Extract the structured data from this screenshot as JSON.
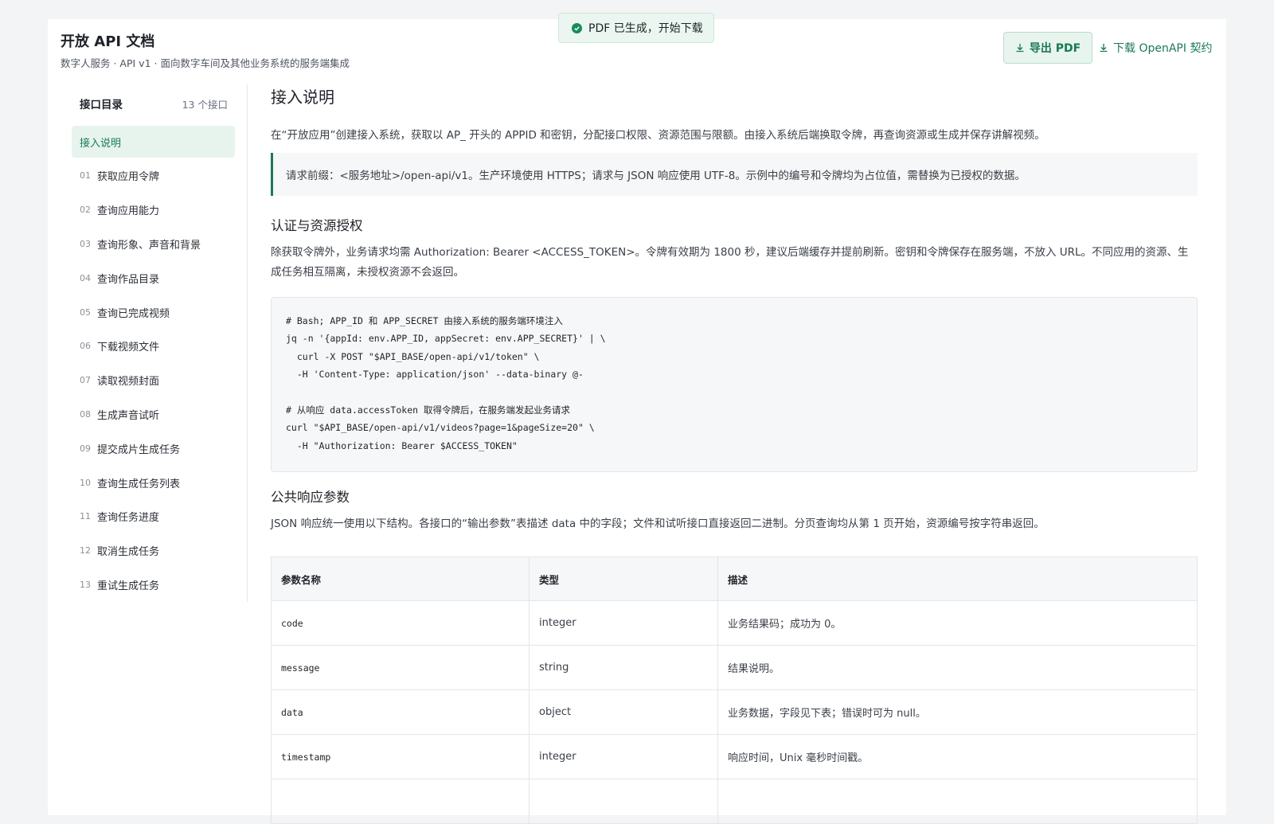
{
  "toast": {
    "text": "PDF 已生成，开始下载"
  },
  "header": {
    "title": "开放 API 文档",
    "subtitle": "数字人服务 · API v1 · 面向数字车间及其他业务系统的服务端集成",
    "export_pdf": "导出 PDF",
    "download_openapi": "下载 OpenAPI 契约"
  },
  "sidebar": {
    "title": "接口目录",
    "count": "13 个接口",
    "items": [
      {
        "num": "",
        "label": "接入说明",
        "active": true
      },
      {
        "num": "01",
        "label": "获取应用令牌"
      },
      {
        "num": "02",
        "label": "查询应用能力"
      },
      {
        "num": "03",
        "label": "查询形象、声音和背景"
      },
      {
        "num": "04",
        "label": "查询作品目录"
      },
      {
        "num": "05",
        "label": "查询已完成视频"
      },
      {
        "num": "06",
        "label": "下载视频文件"
      },
      {
        "num": "07",
        "label": "读取视频封面"
      },
      {
        "num": "08",
        "label": "生成声音试听"
      },
      {
        "num": "09",
        "label": "提交成片生成任务"
      },
      {
        "num": "10",
        "label": "查询生成任务列表"
      },
      {
        "num": "11",
        "label": "查询任务进度"
      },
      {
        "num": "12",
        "label": "取消生成任务"
      },
      {
        "num": "13",
        "label": "重试生成任务"
      }
    ]
  },
  "main": {
    "title": "接入说明",
    "intro": "在“开放应用”创建接入系统，获取以 AP_ 开头的 APPID 和密钥，分配接口权限、资源范围与限额。由接入系统后端换取令牌，再查询资源或生成并保存讲解视频。",
    "note": "请求前缀：<服务地址>/open-api/v1。生产环境使用 HTTPS；请求与 JSON 响应使用 UTF-8。示例中的编号和令牌均为占位值，需替换为已授权的数据。",
    "auth": {
      "title": "认证与资源授权",
      "text": "除获取令牌外，业务请求均需 Authorization: Bearer <ACCESS_TOKEN>。令牌有效期为 1800 秒，建议后端缓存并提前刷新。密钥和令牌保存在服务端，不放入 URL。不同应用的资源、生成任务相互隔离，未授权资源不会返回。"
    },
    "code_lines": [
      "# Bash; APP_ID 和 APP_SECRET 由接入系统的服务端环境注入",
      "jq -n '{appId: env.APP_ID, appSecret: env.APP_SECRET}' | \\",
      "  curl -X POST \"$API_BASE/open-api/v1/token\" \\",
      "  -H 'Content-Type: application/json' --data-binary @-",
      "",
      "# 从响应 data.accessToken 取得令牌后，在服务端发起业务请求",
      "curl \"$API_BASE/open-api/v1/videos?page=1&pageSize=20\" \\",
      "  -H \"Authorization: Bearer $ACCESS_TOKEN\""
    ],
    "response": {
      "title": "公共响应参数",
      "text": "JSON 响应统一使用以下结构。各接口的“输出参数”表描述 data 中的字段；文件和试听接口直接返回二进制。分页查询均从第 1 页开始，资源编号按字符串返回。",
      "columns": [
        "参数名称",
        "类型",
        "描述"
      ],
      "rows": [
        [
          "code",
          "integer",
          "业务结果码；成功为 0。"
        ],
        [
          "message",
          "string",
          "结果说明。"
        ],
        [
          "data",
          "object",
          "业务数据，字段见下表；错误时可为 null。"
        ],
        [
          "timestamp",
          "integer",
          "响应时间，Unix 毫秒时间戳。"
        ],
        [
          "",
          "",
          ""
        ]
      ]
    }
  }
}
